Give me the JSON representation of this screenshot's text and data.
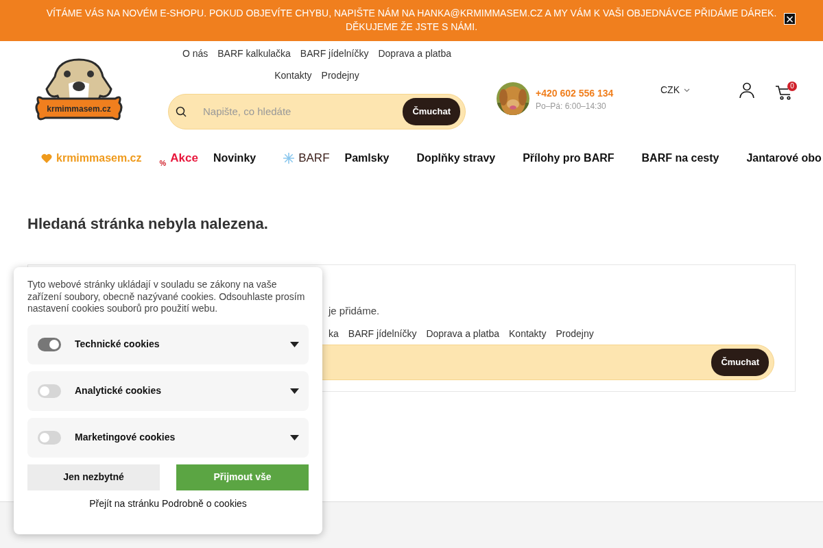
{
  "announcement": {
    "text": "VÍTÁME VÁS NA NOVÉM E-SHOPU. POKUD OBJEVÍTE CHYBU, NAPIŠTE NÁM NA HANKA@KRMIMMASEM.CZ A MY VÁM K VAŠI OBJEDNÁVCE PŘIDÁME DÁREK. DĚKUJEME ŽE JSTE S NÁMI.",
    "close": "×"
  },
  "logo": {
    "text": "krmimmasem.cz"
  },
  "top_links": [
    "O nás",
    "BARF kalkulačka",
    "BARF jídelníčky",
    "Doprava a platba",
    "Kontakty",
    "Prodejny"
  ],
  "search": {
    "placeholder": "Napište, co hledáte",
    "button": "Čmuchat"
  },
  "contact": {
    "phone": "+420 602 556 134",
    "hours": "Po–Pá: 6:00–14:30"
  },
  "currency": "CZK",
  "cart": {
    "count": "0"
  },
  "menu": [
    {
      "label": "krmimmasem.cz",
      "kind": "heart"
    },
    {
      "label": "Akce",
      "kind": "sale"
    },
    {
      "label": "Novinky",
      "kind": "plain"
    },
    {
      "label": "BARF",
      "kind": "frost"
    },
    {
      "label": "Pamlsky",
      "kind": "plain"
    },
    {
      "label": "Doplňky stravy",
      "kind": "plain"
    },
    {
      "label": "Přílohy pro BARF",
      "kind": "plain"
    },
    {
      "label": "BARF na cesty",
      "kind": "plain"
    },
    {
      "label": "Jantarové obo",
      "kind": "plain"
    }
  ],
  "sale_mark": "%",
  "heading": "Hledaná stránka nebyla nalezena.",
  "notfound_box": {
    "text": "je přidáme.",
    "links": [
      "ka",
      "BARF jídelníčky",
      "Doprava a platba",
      "Kontakty",
      "Prodejny"
    ],
    "button": "Čmuchat"
  },
  "cookies": {
    "text": "Tyto webové stránky ukládají v souladu se zákony na vaše zařízení soubory, obecně nazývané cookies. Odsouhlaste prosím nastavení cookies souborů pro použití webu.",
    "categories": [
      {
        "label": "Technické cookies",
        "on": true
      },
      {
        "label": "Analytické cookies",
        "on": false
      },
      {
        "label": "Marketingové cookies",
        "on": false
      }
    ],
    "reject": "Jen nezbytné",
    "accept": "Přijmout vše",
    "details": "Přejít na stránku Podrobně o cookies"
  }
}
